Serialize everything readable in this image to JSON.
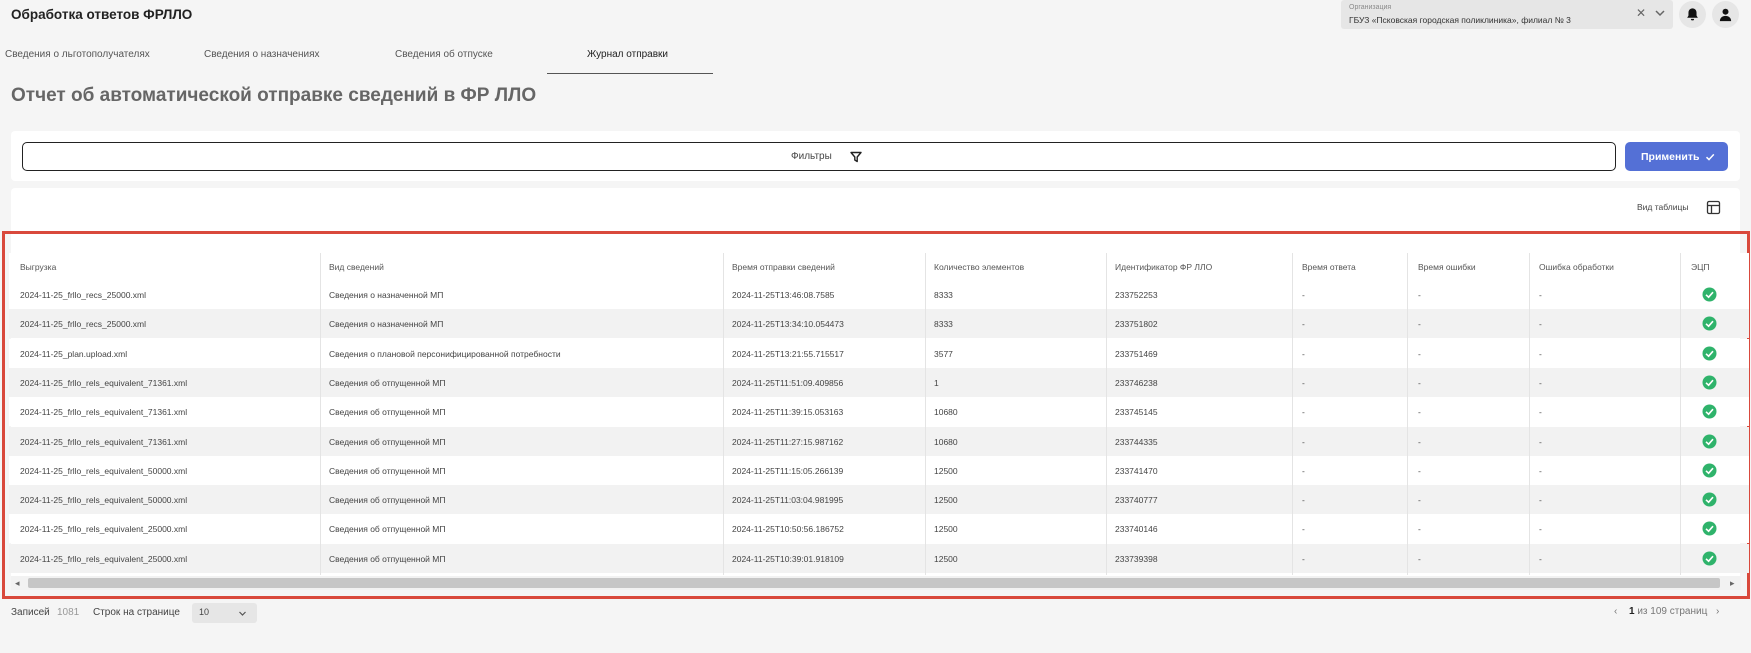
{
  "app": {
    "title": "Обработка ответов ФРЛЛО"
  },
  "organization": {
    "label": "Организация",
    "value": "ГБУЗ «Псковская городская поликлиника», филиал № 3",
    "clear_icon": "close-icon",
    "chevron_icon": "chevron-down-icon"
  },
  "header_icons": {
    "notifications": "bell-icon",
    "profile": "user-icon"
  },
  "tabs": [
    {
      "label": "Сведения о льготополучателях",
      "active": false
    },
    {
      "label": "Сведения о назначениях",
      "active": false
    },
    {
      "label": "Сведения об отпуске",
      "active": false
    },
    {
      "label": "Журнал отправки",
      "active": true
    }
  ],
  "page": {
    "title": "Отчет об автоматической отправке сведений в ФР ЛЛО"
  },
  "filters": {
    "label": "Фильтры",
    "icon": "filter-icon",
    "apply_label": "Применить",
    "apply_icon": "check-icon"
  },
  "table_view": {
    "label": "Вид таблицы",
    "icon": "table-layout-icon"
  },
  "table": {
    "columns": [
      "Выгрузка",
      "Вид сведений",
      "Время отправки сведений",
      "Количество элементов",
      "Идентификатор ФР ЛЛО",
      "Время ответа",
      "Время ошибки",
      "Ошибка обработки",
      "ЭЦП"
    ],
    "rows": [
      {
        "file": "2024-11-25_frllo_recs_25000.xml",
        "kind": "Сведения о назначенной МП",
        "sent": "2024-11-25T13:46:08.7585",
        "count": "8333",
        "id": "233752253",
        "resp": "-",
        "err_time": "-",
        "err": "-",
        "ecp": "check-circle-icon"
      },
      {
        "file": "2024-11-25_frllo_recs_25000.xml",
        "kind": "Сведения о назначенной МП",
        "sent": "2024-11-25T13:34:10.054473",
        "count": "8333",
        "id": "233751802",
        "resp": "-",
        "err_time": "-",
        "err": "-",
        "ecp": "check-circle-icon"
      },
      {
        "file": "2024-11-25_plan.upload.xml",
        "kind": "Сведения о плановой персонифицированной потребности",
        "sent": "2024-11-25T13:21:55.715517",
        "count": "3577",
        "id": "233751469",
        "resp": "-",
        "err_time": "-",
        "err": "-",
        "ecp": "check-circle-icon"
      },
      {
        "file": "2024-11-25_frllo_rels_equivalent_71361.xml",
        "kind": "Сведения об отпущенной МП",
        "sent": "2024-11-25T11:51:09.409856",
        "count": "1",
        "id": "233746238",
        "resp": "-",
        "err_time": "-",
        "err": "-",
        "ecp": "check-circle-icon"
      },
      {
        "file": "2024-11-25_frllo_rels_equivalent_71361.xml",
        "kind": "Сведения об отпущенной МП",
        "sent": "2024-11-25T11:39:15.053163",
        "count": "10680",
        "id": "233745145",
        "resp": "-",
        "err_time": "-",
        "err": "-",
        "ecp": "check-circle-icon"
      },
      {
        "file": "2024-11-25_frllo_rels_equivalent_71361.xml",
        "kind": "Сведения об отпущенной МП",
        "sent": "2024-11-25T11:27:15.987162",
        "count": "10680",
        "id": "233744335",
        "resp": "-",
        "err_time": "-",
        "err": "-",
        "ecp": "check-circle-icon"
      },
      {
        "file": "2024-11-25_frllo_rels_equivalent_50000.xml",
        "kind": "Сведения об отпущенной МП",
        "sent": "2024-11-25T11:15:05.266139",
        "count": "12500",
        "id": "233741470",
        "resp": "-",
        "err_time": "-",
        "err": "-",
        "ecp": "check-circle-icon"
      },
      {
        "file": "2024-11-25_frllo_rels_equivalent_50000.xml",
        "kind": "Сведения об отпущенной МП",
        "sent": "2024-11-25T11:03:04.981995",
        "count": "12500",
        "id": "233740777",
        "resp": "-",
        "err_time": "-",
        "err": "-",
        "ecp": "check-circle-icon"
      },
      {
        "file": "2024-11-25_frllo_rels_equivalent_25000.xml",
        "kind": "Сведения об отпущенной МП",
        "sent": "2024-11-25T10:50:56.186752",
        "count": "12500",
        "id": "233740146",
        "resp": "-",
        "err_time": "-",
        "err": "-",
        "ecp": "check-circle-icon"
      },
      {
        "file": "2024-11-25_frllo_rels_equivalent_25000.xml",
        "kind": "Сведения об отпущенной МП",
        "sent": "2024-11-25T10:39:01.918109",
        "count": "12500",
        "id": "233739398",
        "resp": "-",
        "err_time": "-",
        "err": "-",
        "ecp": "check-circle-icon"
      }
    ]
  },
  "footer": {
    "records_label": "Записей",
    "records_count": "1081",
    "rows_per_page_label": "Строк на странице",
    "rows_per_page": "10",
    "current_page": "1",
    "of_pages": "из 109 страниц"
  },
  "colors": {
    "accent": "#5470d6",
    "highlight_frame": "#d9493c",
    "ecp_ok": "#2fb36b"
  }
}
